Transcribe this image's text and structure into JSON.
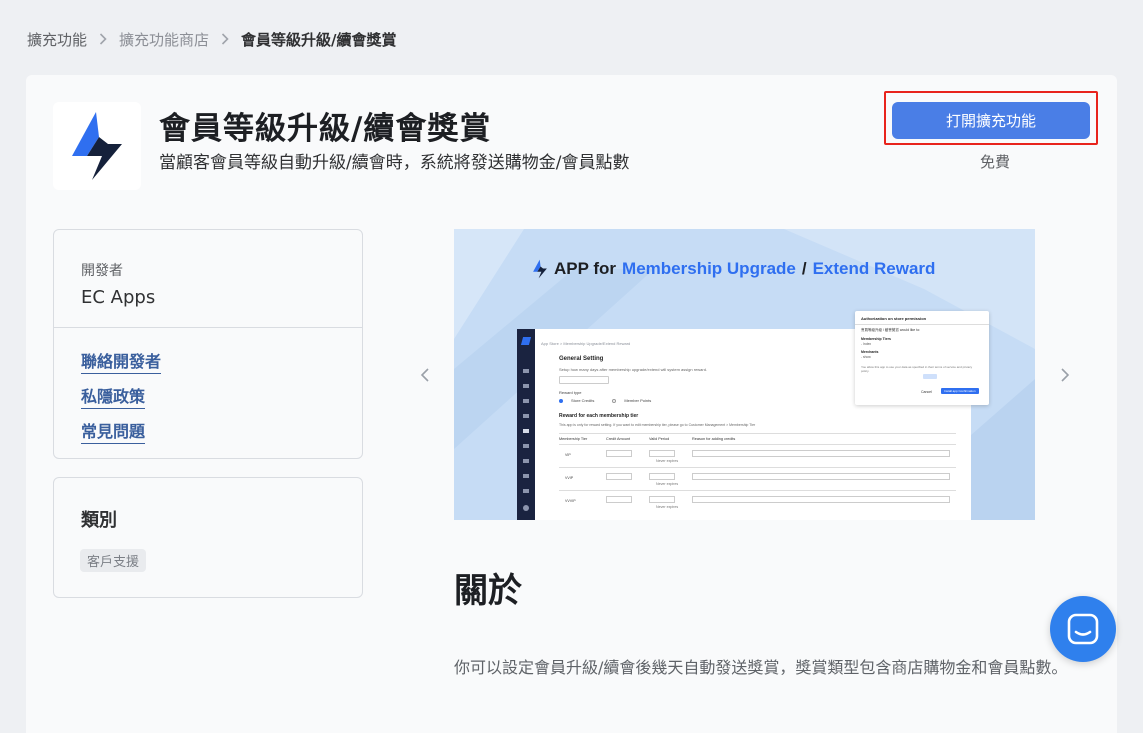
{
  "breadcrumb": {
    "items": [
      "擴充功能",
      "擴充功能商店"
    ],
    "current": "會員等級升級/續會獎賞"
  },
  "app": {
    "title": "會員等級升級/續會獎賞",
    "subtitle": "當顧客會員等級自動升級/續會時，系統將發送購物金/會員點數",
    "icon": "shopline-logo-icon",
    "install_label": "打開擴充功能",
    "price": "免費",
    "colors": {
      "primary": "#4a7ee6",
      "highlight": "#e8231c",
      "link": "#3a5f9d"
    }
  },
  "developer": {
    "label": "開發者",
    "name": "EC Apps",
    "links": [
      "聯絡開發者",
      "私隱政策",
      "常見問題"
    ]
  },
  "category": {
    "title": "類別",
    "tag": "客戶支援"
  },
  "screenshot": {
    "headline_prefix": "APP for",
    "headline_part1": "Membership Upgrade",
    "headline_sep": "/",
    "headline_part2": "Extend Reward",
    "breadcrumb": "App Store > Membership Upgrade/Extend Reward",
    "section_title": "General Setting",
    "section_desc": "Setup how many days after membership upgrade/extend will system assign reward.",
    "reward_type_label": "Reward type",
    "reward_options": [
      "Store Credits",
      "Member Points"
    ],
    "tier_title": "Reward for each membership tier",
    "tier_desc": "This app is only for reward setting. If you want to edit membership tier, please go to Customer Management > Membership Tier",
    "table_headers": [
      "Membership Tier",
      "Credit Amount",
      "Valid Period",
      "Reason for adding credits"
    ],
    "tiers": [
      "VIP",
      "VVIP",
      "VVVIP"
    ],
    "never_expires": "Never expires",
    "dialog": {
      "title": "Authorization on store permission",
      "subtitle": "會員等級升級 / 續會獎賞 would like to:",
      "perm1_title": "Membership Tiers",
      "perm1_desc": "- Index",
      "perm2_title": "Merchants",
      "perm2_desc": "- show",
      "footer": "You allow this app to use your data as specified in their terms of service and privacy policy.",
      "cancel": "Cancel",
      "confirm": "Install app Confirmation"
    }
  },
  "about": {
    "title": "關於",
    "text": "你可以設定會員升級/續會後幾天自動發送獎賞，獎賞類型包含商店購物金和會員點數。"
  },
  "chat": {
    "icon": "chat-icon"
  }
}
